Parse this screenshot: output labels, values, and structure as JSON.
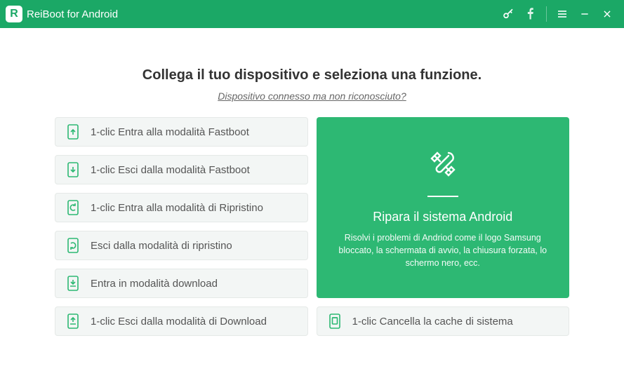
{
  "app": {
    "title": "ReiBoot for Android",
    "logo_letter": "R"
  },
  "colors": {
    "primary": "#1ba866",
    "card": "#2db873"
  },
  "main": {
    "heading": "Collega il tuo dispositivo e seleziona una funzione.",
    "sublink": "Dispositivo connesso ma non riconosciuto?"
  },
  "options": {
    "fastboot_enter": "1-clic Entra alla modalità Fastboot",
    "fastboot_exit": "1-clic Esci dalla modalità Fastboot",
    "recovery_enter": "1-clic Entra alla modalità di Ripristino",
    "recovery_exit": "Esci dalla modalità di ripristino",
    "download_enter": "Entra in modalità download",
    "download_exit": "1-clic Esci dalla modalità di Download",
    "clear_cache": "1-clic Cancella la cache di sistema"
  },
  "repair": {
    "title": "Ripara il sistema Android",
    "desc": "Risolvi i problemi di Andriod come il logo Samsung bloccato, la schermata di avvio, la chiusura forzata, lo schermo nero, ecc."
  }
}
